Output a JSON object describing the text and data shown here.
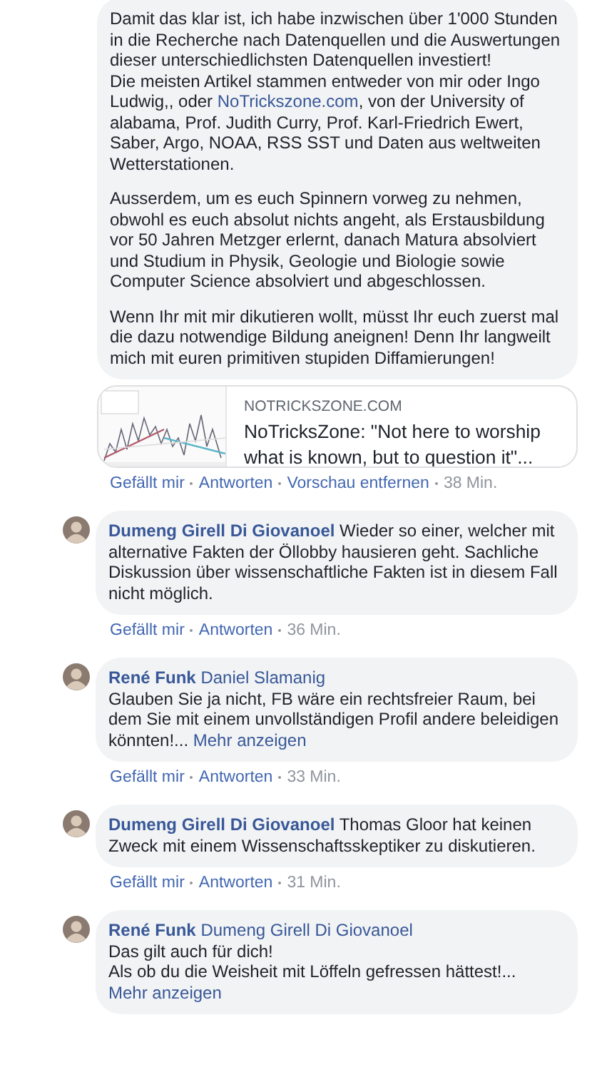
{
  "post_comment": {
    "paragraphs": [
      [
        {
          "kind": "text",
          "text": "Damit das klar ist, ich habe inzwischen über 1'000 Stunden in die Recherche nach Datenquellen und die Auswertungen dieser unterschiedlichsten Datenquellen investiert!\nDie meisten Artikel stammen entweder von mir oder Ingo Ludwig,, oder "
        },
        {
          "kind": "link",
          "text": "NoTrickszone.com"
        },
        {
          "kind": "text",
          "text": ", von der University of alabama, Prof. Judith Curry, Prof. Karl-Friedrich Ewert, Saber, Argo, NOAA, RSS SST und Daten aus weltweiten Wetterstationen."
        }
      ],
      [
        {
          "kind": "text",
          "text": "Ausserdem, um es euch Spinnern vorweg zu nehmen, obwohl es euch absolut nichts angeht, als Erstausbildung vor 50 Jahren Metzger erlernt, danach Matura absolviert und Studium in Physik, Geologie und Biologie sowie Computer Science absolviert und abgeschlossen."
        }
      ],
      [
        {
          "kind": "text",
          "text": "Wenn Ihr mit mir dikutieren wollt, müsst Ihr euch zuerst mal die dazu notwendige Bildung aneignen! Denn Ihr langweilt mich mit euren primitiven stupiden Diffamierungen!"
        }
      ]
    ],
    "link_preview": {
      "domain": "NOTRICKSZONE.COM",
      "title": "NoTricksZone: \"Not here to worship what is known, but to question it\"..."
    },
    "actions": [
      {
        "kind": "link",
        "label": "Gefällt mir"
      },
      {
        "kind": "link",
        "label": "Antworten"
      },
      {
        "kind": "link",
        "label": "Vorschau entfernen"
      },
      {
        "kind": "time",
        "label": "38 Min."
      }
    ]
  },
  "comments": [
    {
      "author": "Dumeng Girell Di Giovanoel",
      "text": "Wieder so einer, welcher mit alternative Fakten der Öllobby hausieren geht. Sachliche Diskussion über wissenschaftliche Fakten ist in diesem Fall nicht möglich.",
      "actions": [
        {
          "kind": "link",
          "label": "Gefällt mir"
        },
        {
          "kind": "link",
          "label": "Antworten"
        },
        {
          "kind": "time",
          "label": "36 Min."
        }
      ]
    },
    {
      "author": "René Funk",
      "mention": "Daniel Slamanig",
      "text": "Glauben Sie ja nicht, FB wäre ein rechtsfreier Raum, bei dem Sie mit einem unvollständigen Profil andere beleidigen könnten!...",
      "more": "Mehr anzeigen",
      "actions": [
        {
          "kind": "link",
          "label": "Gefällt mir"
        },
        {
          "kind": "link",
          "label": "Antworten"
        },
        {
          "kind": "time",
          "label": "33 Min."
        }
      ]
    },
    {
      "author": "Dumeng Girell Di Giovanoel",
      "text": "Thomas Gloor hat keinen Zweck mit einem Wissenschaftsskeptiker zu diskutieren.",
      "actions": [
        {
          "kind": "link",
          "label": "Gefällt mir"
        },
        {
          "kind": "link",
          "label": "Antworten"
        },
        {
          "kind": "time",
          "label": "31 Min."
        }
      ]
    },
    {
      "author": "René Funk",
      "mention": "Dumeng Girell Di Giovanoel",
      "text": "Das gilt auch für dich!\nAls ob du die Weisheit mit Löffeln gefressen hättest!...",
      "more": "Mehr anzeigen"
    }
  ]
}
